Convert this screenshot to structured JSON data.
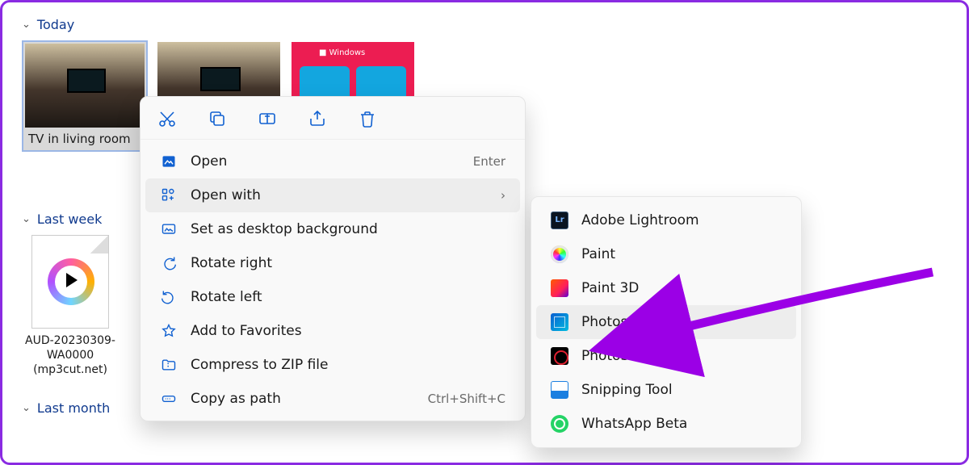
{
  "groups": {
    "today": "Today",
    "lastweek": "Last week",
    "lastmonth": "Last month"
  },
  "thumbnails": [
    {
      "caption": "TV in living room"
    }
  ],
  "audio": {
    "line1": "AUD-20230309-",
    "line2": "WA0000",
    "line3": "(mp3cut.net)"
  },
  "menu": {
    "open": {
      "label": "Open",
      "hint": "Enter"
    },
    "openwith": {
      "label": "Open with"
    },
    "setbg": {
      "label": "Set as desktop background"
    },
    "rotr": {
      "label": "Rotate right"
    },
    "rotl": {
      "label": "Rotate left"
    },
    "fav": {
      "label": "Add to Favorites"
    },
    "zip": {
      "label": "Compress to ZIP file"
    },
    "copypath": {
      "label": "Copy as path",
      "hint": "Ctrl+Shift+C"
    }
  },
  "submenu": {
    "lr": "Adobe Lightroom",
    "paint": "Paint",
    "p3d": "Paint 3D",
    "photos": "Photos",
    "psx": "PhotoScape X",
    "snip": "Snipping Tool",
    "wa": "WhatsApp Beta"
  }
}
